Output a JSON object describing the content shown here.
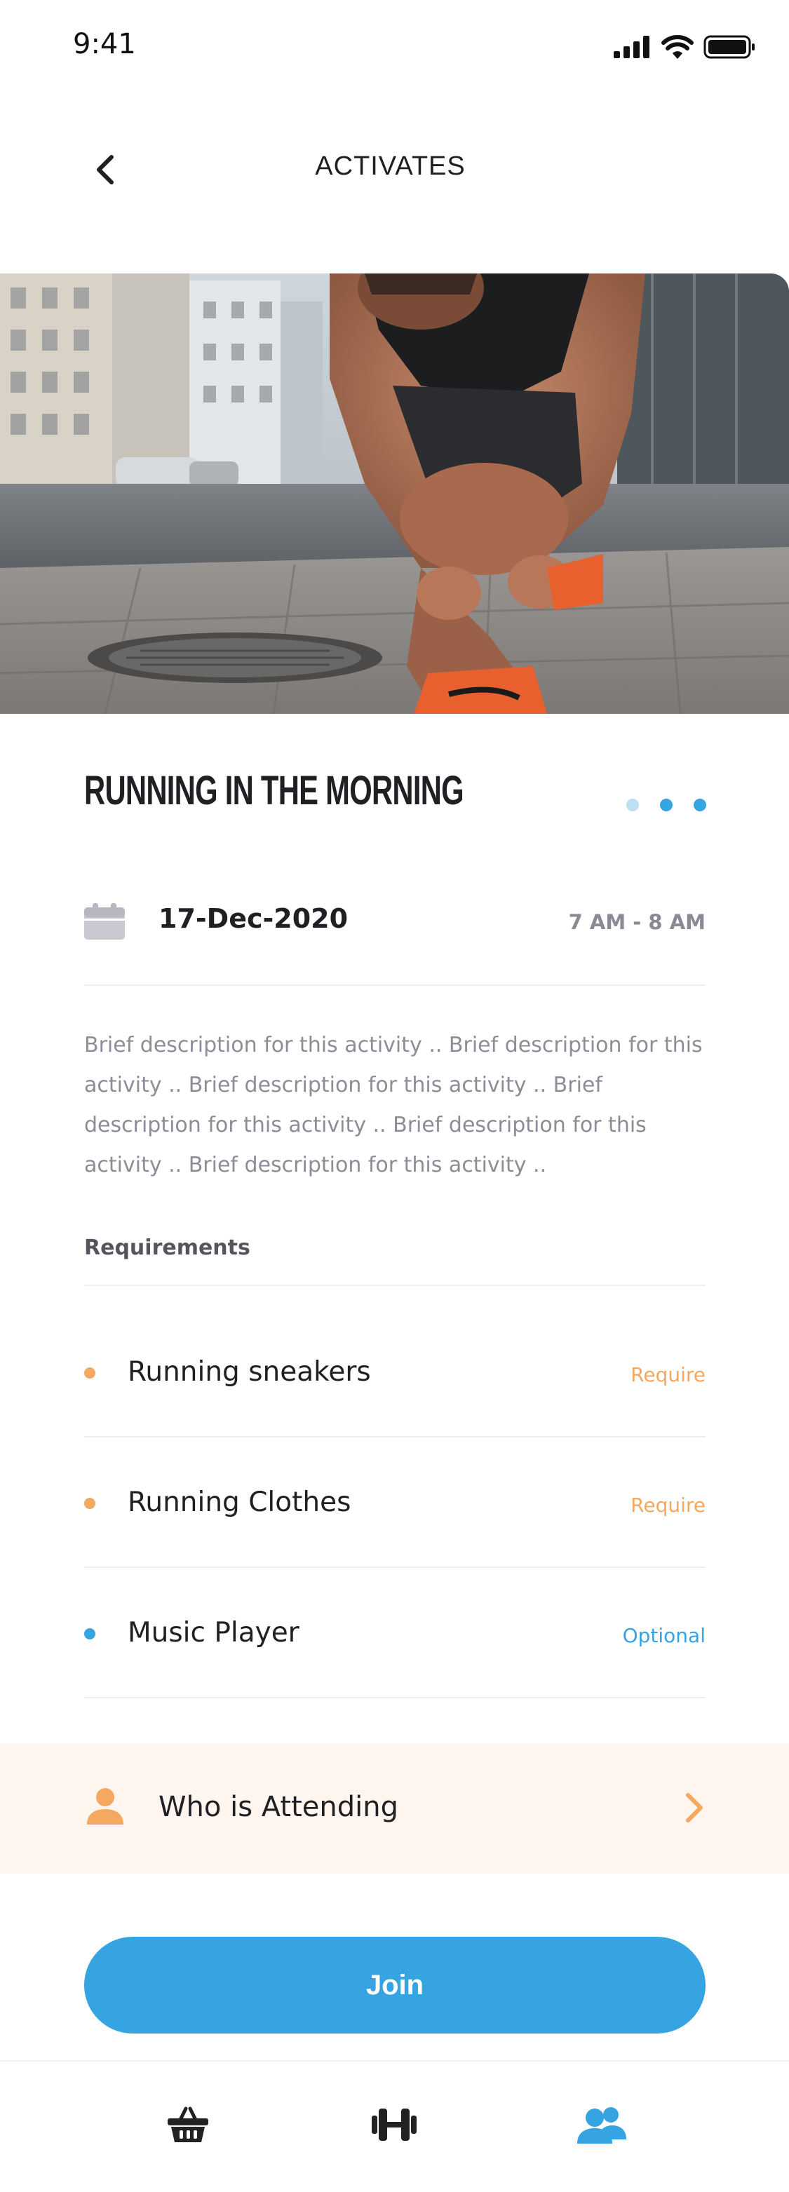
{
  "status_bar": {
    "time": "9:41"
  },
  "nav": {
    "title": "ACTIVATES"
  },
  "activity": {
    "title": "RUNNING IN THE MORNING",
    "date": "17-Dec-2020",
    "time": "7 AM - 8 AM",
    "description": "Brief description for this activity .. Brief description for this activity .. Brief description for this activity .. Brief description for this activity .. Brief description for this activity .. Brief description for this activity .."
  },
  "requirements": {
    "heading": "Requirements",
    "items": [
      {
        "name": "Running sneakers",
        "tag": "Require"
      },
      {
        "name": "Running Clothes",
        "tag": "Require"
      },
      {
        "name": "Music Player",
        "tag": "Optional"
      }
    ]
  },
  "attending": {
    "label": "Who is Attending"
  },
  "join": {
    "label": "Join"
  },
  "carousel": {
    "total": 3
  },
  "colors": {
    "accent": "#35a4e1",
    "require": "#f5a860",
    "optional": "#35a4e1",
    "attending_bg": "#fef6ee"
  },
  "icons": {
    "back": "chevron-left-icon",
    "calendar": "calendar-icon",
    "person": "person-icon",
    "chevron": "chevron-right-icon",
    "tabs": [
      "basket-icon",
      "dumbbell-icon",
      "group-icon"
    ]
  }
}
